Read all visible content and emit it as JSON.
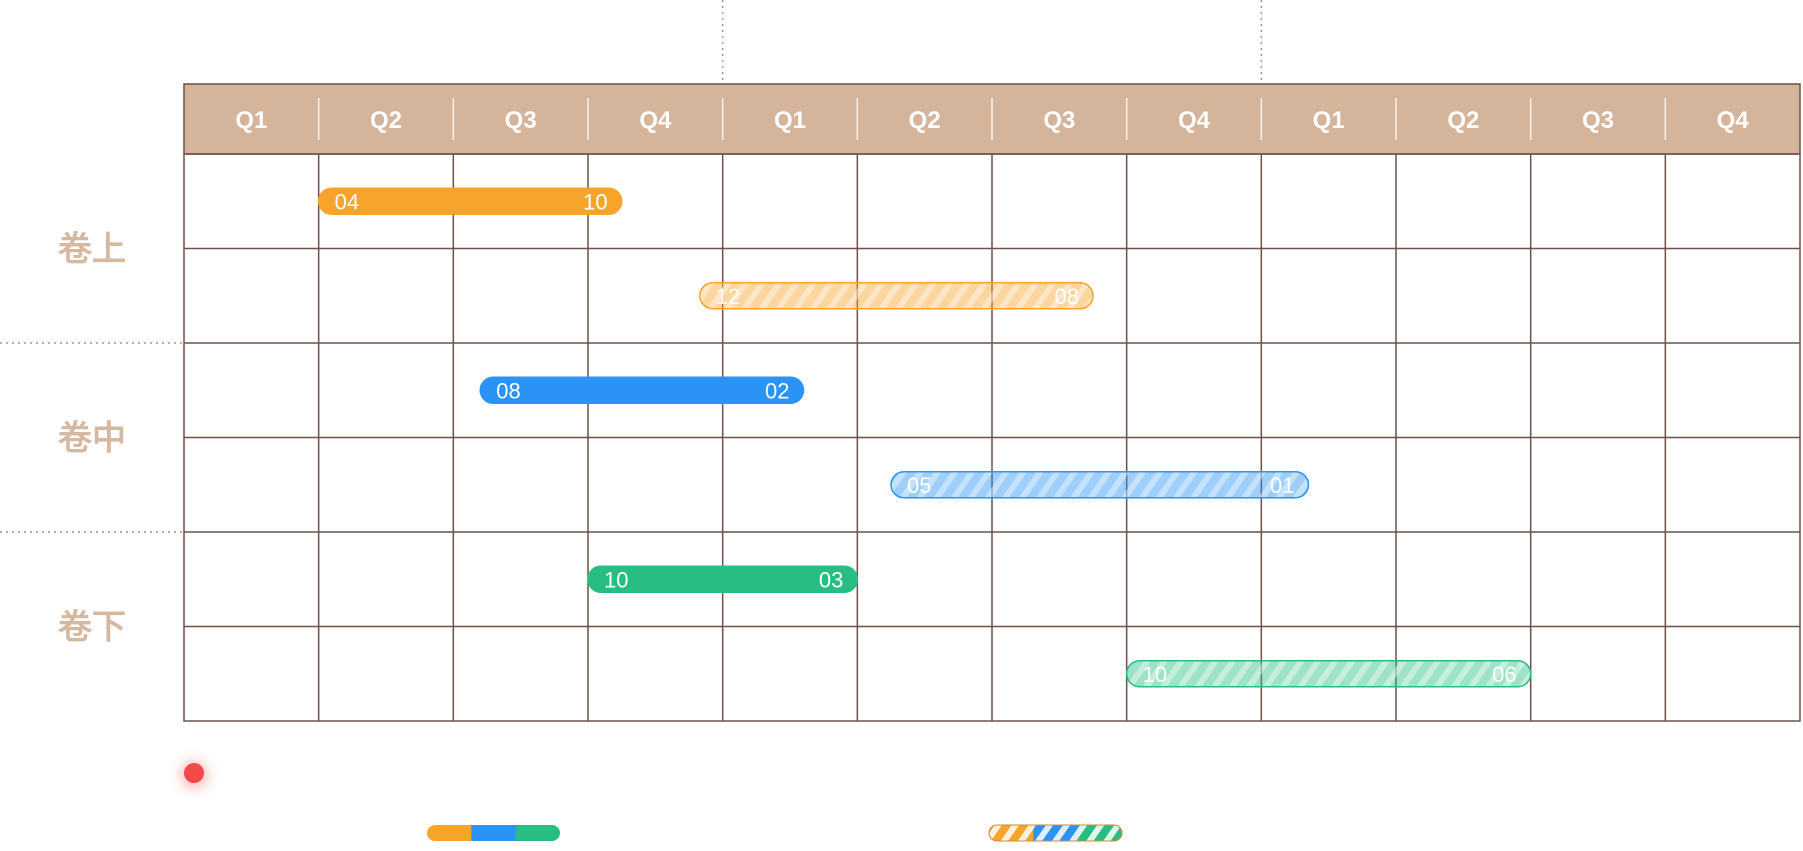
{
  "chart_data": {
    "type": "gantt",
    "quarters": [
      "Q1",
      "Q2",
      "Q3",
      "Q4",
      "Q1",
      "Q2",
      "Q3",
      "Q4",
      "Q1",
      "Q2",
      "Q3",
      "Q4"
    ],
    "volumes": [
      "卷上",
      "卷中",
      "卷下"
    ],
    "bars": [
      {
        "row": 0,
        "start": 1.0,
        "end": 3.25,
        "start_label": "04",
        "end_label": "10",
        "color": "#f7a42b",
        "style": "solid"
      },
      {
        "row": 1,
        "start": 3.83,
        "end": 6.75,
        "start_label": "12",
        "end_label": "08",
        "color": "#f7a42b",
        "style": "striped"
      },
      {
        "row": 2,
        "start": 2.2,
        "end": 4.6,
        "start_label": "08",
        "end_label": "02",
        "color": "#2b93f5",
        "style": "solid"
      },
      {
        "row": 3,
        "start": 5.25,
        "end": 8.35,
        "start_label": "05",
        "end_label": "01",
        "color": "#2b93f5",
        "style": "striped"
      },
      {
        "row": 4,
        "start": 3.0,
        "end": 5.0,
        "start_label": "10",
        "end_label": "03",
        "color": "#28be83",
        "style": "solid"
      },
      {
        "row": 5,
        "start": 7.0,
        "end": 10.0,
        "start_label": "10",
        "end_label": "06",
        "color": "#28be83",
        "style": "striped"
      }
    ],
    "legend": [
      {
        "style": "solid",
        "colors": [
          "#f7a42b",
          "#2b93f5",
          "#28be83"
        ]
      },
      {
        "style": "striped",
        "colors": [
          "#f7a42b",
          "#2b93f5",
          "#28be83"
        ]
      }
    ]
  },
  "colors": {
    "header_bg": "#d4b49a",
    "grid": "#6e5048",
    "volume_label": "#d4b8a0",
    "marker": "#f44a4a"
  }
}
